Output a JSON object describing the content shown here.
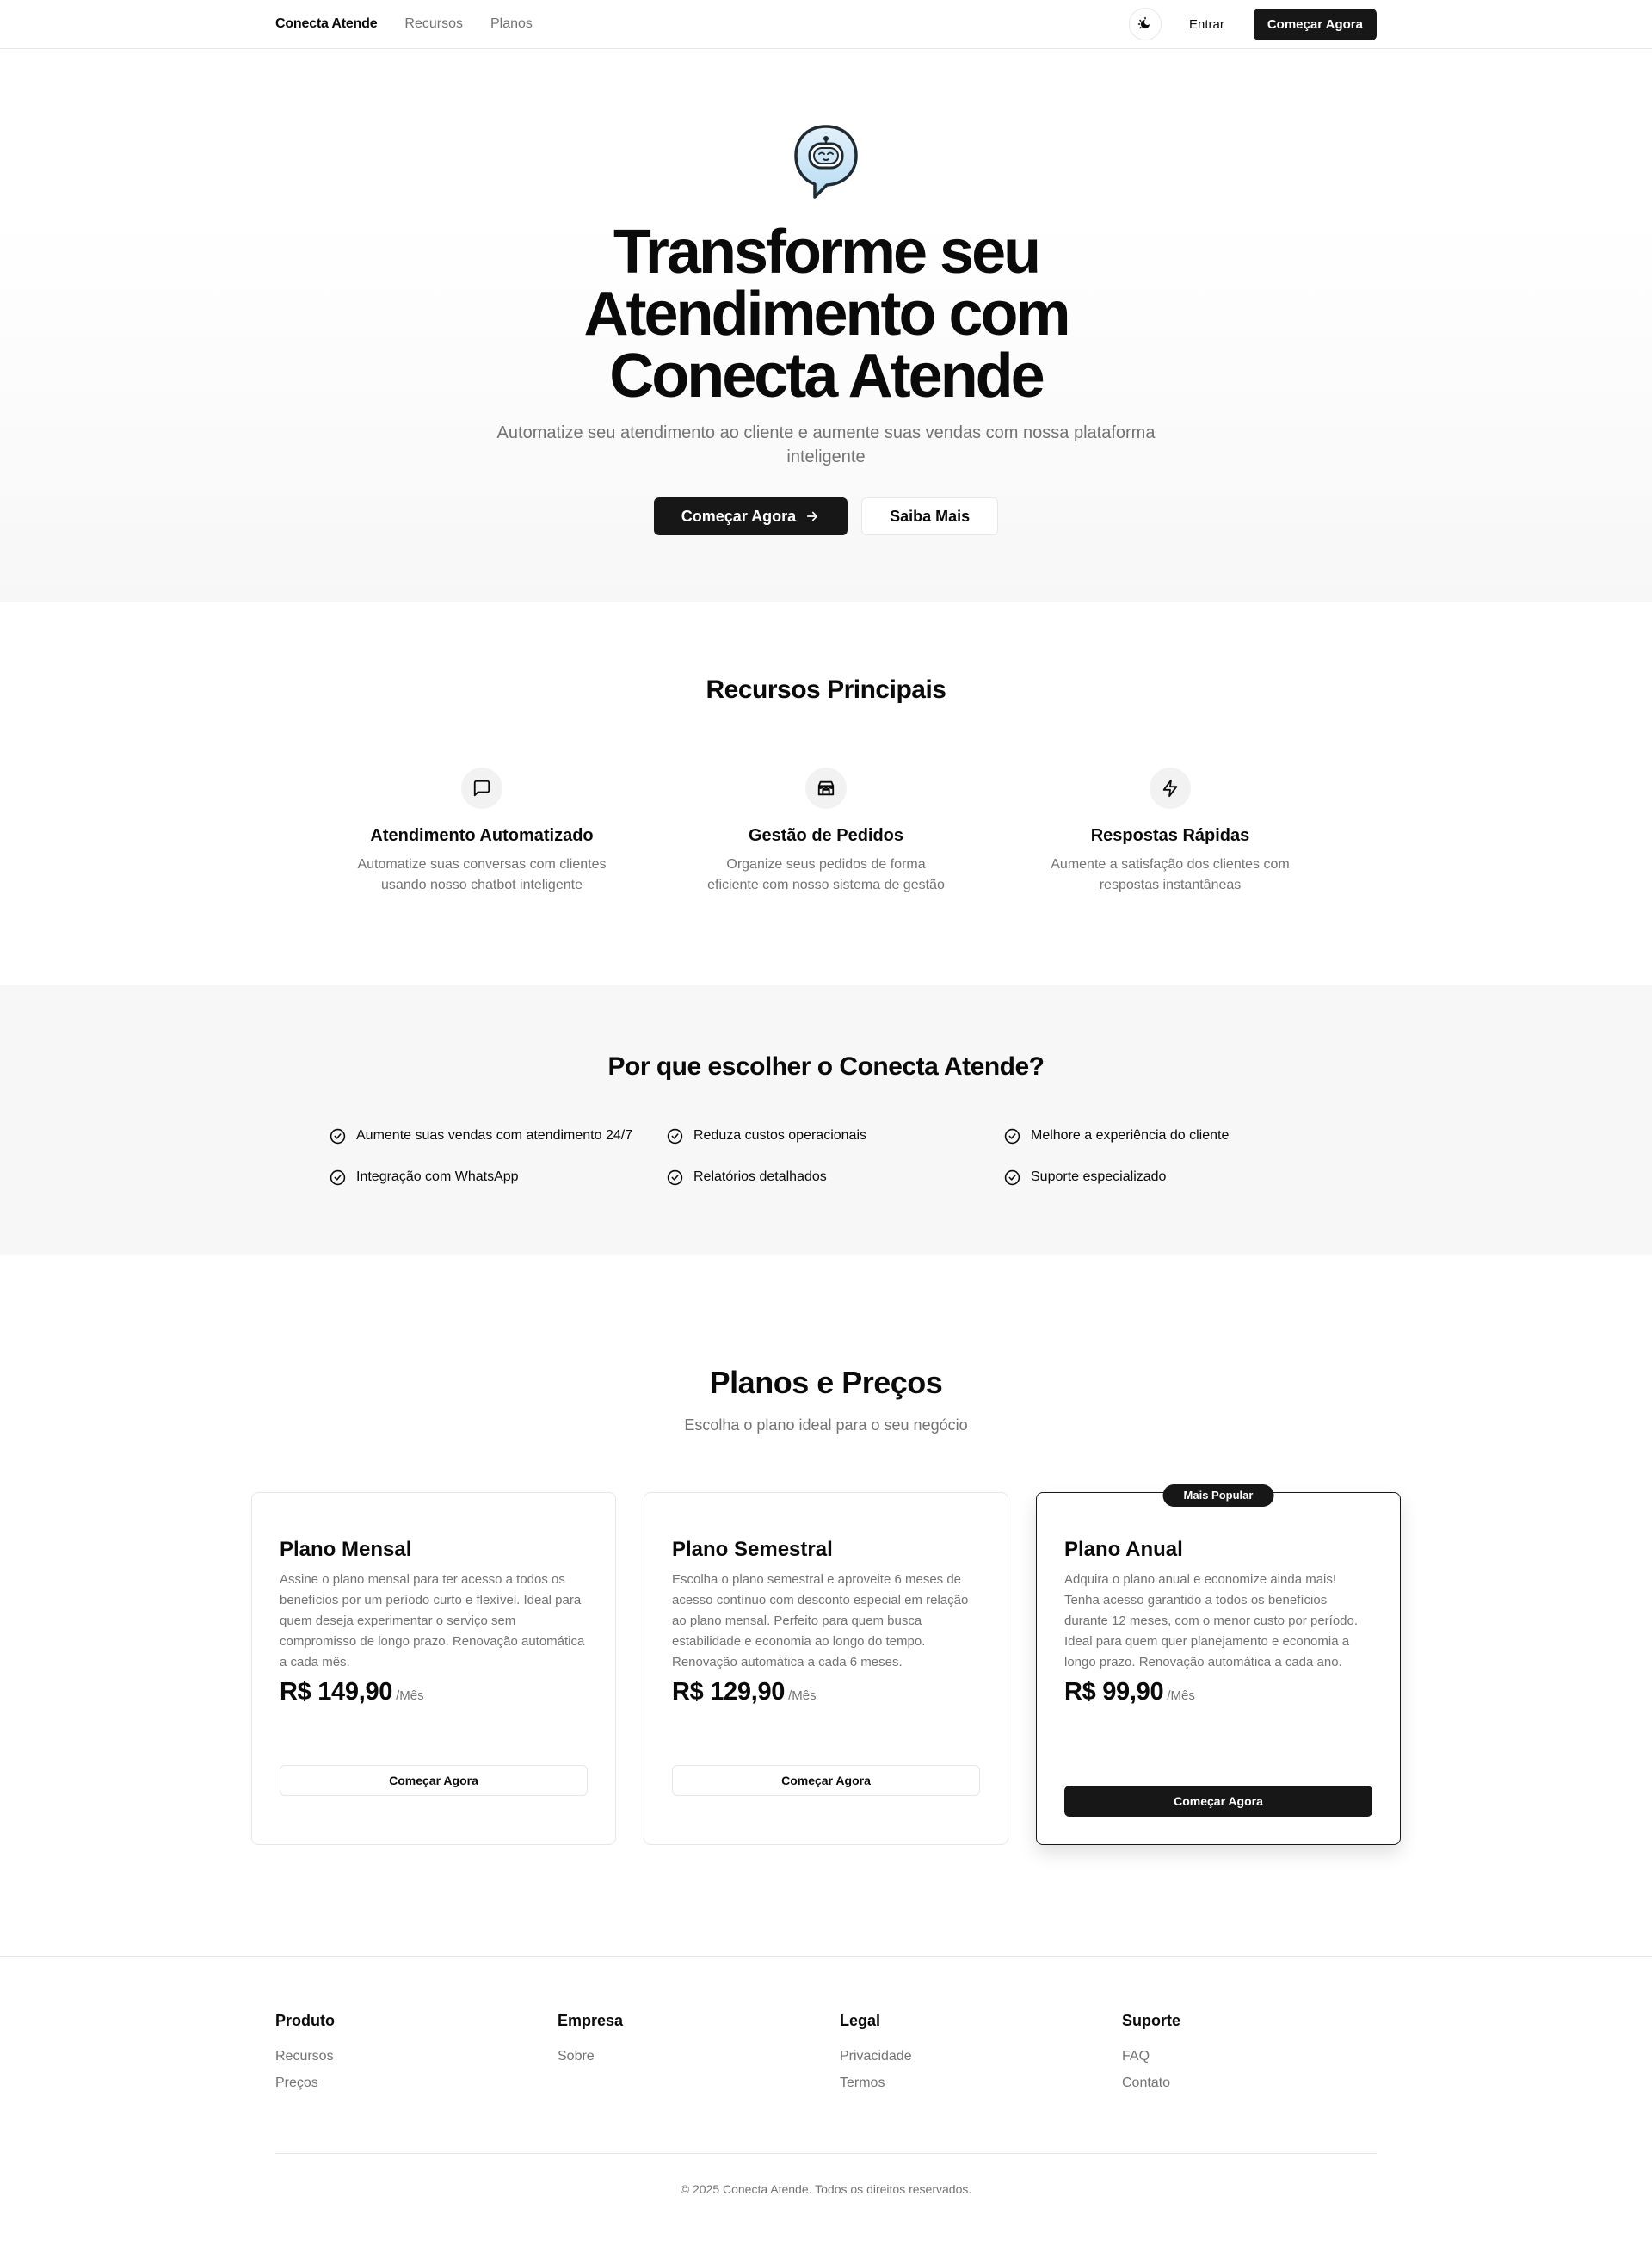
{
  "nav": {
    "brand": "Conecta Atende",
    "links": [
      "Recursos",
      "Planos"
    ],
    "theme_icon": "moon-sun-icon",
    "login": "Entrar",
    "cta": "Começar Agora"
  },
  "hero": {
    "logo_icon": "chat-robot-icon",
    "title": "Transforme seu Atendimento com Conecta Atende",
    "subtitle": "Automatize seu atendimento ao cliente e aumente suas vendas com nossa plataforma inteligente",
    "primary_cta": "Começar Agora",
    "secondary_cta": "Saiba Mais"
  },
  "features": {
    "title": "Recursos Principais",
    "items": [
      {
        "icon": "message-square-icon",
        "title": "Atendimento Automatizado",
        "desc": "Automatize suas conversas com clientes usando nosso chatbot inteligente"
      },
      {
        "icon": "store-icon",
        "title": "Gestão de Pedidos",
        "desc": "Organize seus pedidos de forma eficiente com nosso sistema de gestão"
      },
      {
        "icon": "zap-icon",
        "title": "Respostas Rápidas",
        "desc": "Aumente a satisfação dos clientes com respostas instantâneas"
      }
    ]
  },
  "why": {
    "title": "Por que escolher o Conecta Atende?",
    "items": [
      "Aumente suas vendas com atendimento 24/7",
      "Reduza custos operacionais",
      "Melhore a experiência do cliente",
      "Integração com WhatsApp",
      "Relatórios detalhados",
      "Suporte especializado"
    ]
  },
  "pricing": {
    "title": "Planos e Preços",
    "subtitle": "Escolha o plano ideal para o seu negócio",
    "plans": [
      {
        "name": "Plano Mensal",
        "desc": "Assine o plano mensal para ter acesso a todos os benefícios por um período curto e flexível. Ideal para quem deseja experimentar o serviço sem compromisso de longo prazo. Renovação automática a cada mês.",
        "price": "R$ 149,90",
        "unit": "/Mês",
        "cta": "Começar Agora"
      },
      {
        "name": "Plano Semestral",
        "desc": "Escolha o plano semestral e aproveite 6 meses de acesso contínuo com desconto especial em relação ao plano mensal. Perfeito para quem busca estabilidade e economia ao longo do tempo. Renovação automática a cada 6 meses.",
        "price": "R$ 129,90",
        "unit": "/Mês",
        "cta": "Começar Agora"
      },
      {
        "name": "Plano Anual",
        "badge": "Mais Popular",
        "desc": "Adquira o plano anual e economize ainda mais! Tenha acesso garantido a todos os benefícios durante 12 meses, com o menor custo por período. Ideal para quem quer planejamento e economia a longo prazo. Renovação automática a cada ano.",
        "price": "R$ 99,90",
        "unit": "/Mês",
        "cta": "Começar Agora"
      }
    ]
  },
  "footer": {
    "columns": [
      {
        "title": "Produto",
        "links": [
          "Recursos",
          "Preços"
        ]
      },
      {
        "title": "Empresa",
        "links": [
          "Sobre"
        ]
      },
      {
        "title": "Legal",
        "links": [
          "Privacidade",
          "Termos"
        ]
      },
      {
        "title": "Suporte",
        "links": [
          "FAQ",
          "Contato"
        ]
      }
    ],
    "copyright": "© 2025 Conecta Atende. Todos os direitos reservados."
  },
  "colors": {
    "primary": "#171717",
    "muted": "#737373",
    "border": "#e5e7eb",
    "section_bg": "#f7f7f8"
  }
}
